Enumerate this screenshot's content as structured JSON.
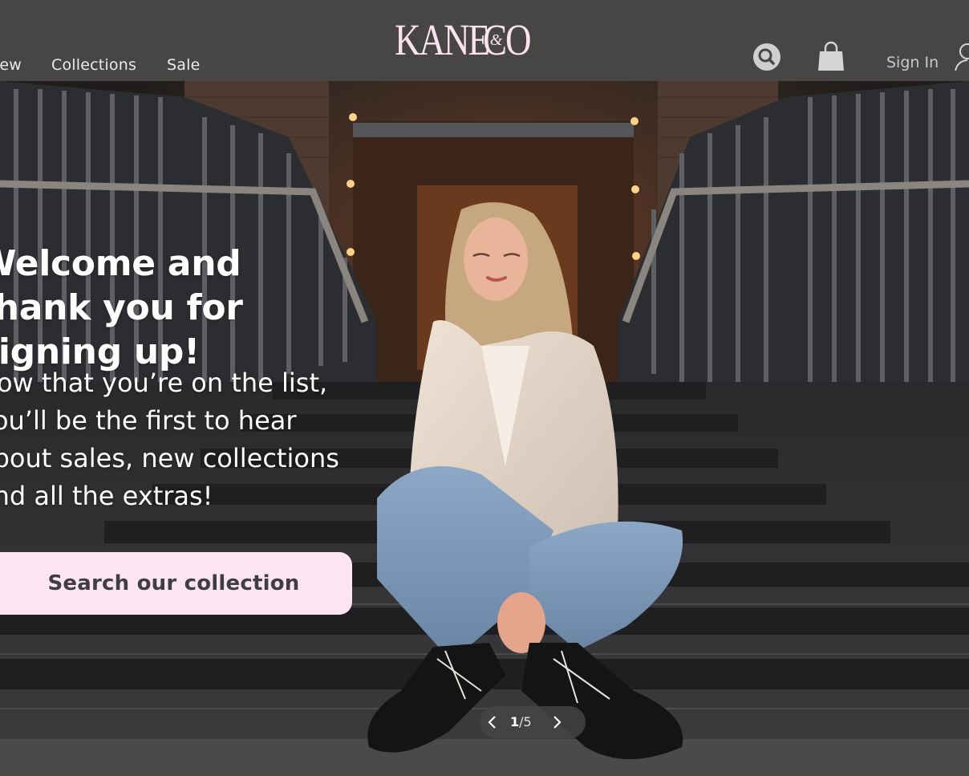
{
  "header": {
    "nav": [
      {
        "label": "New"
      },
      {
        "label": "Collections"
      },
      {
        "label": "Sale"
      }
    ],
    "logo_text": "KANE&CO",
    "logo_main_left": "KANE",
    "logo_amp": "&",
    "logo_main_right": "CO",
    "sign_in_label": "Sign In",
    "icons": [
      "search-icon",
      "shopping-bag-icon",
      "user-icon"
    ]
  },
  "hero": {
    "headline": "Welcome and thank you for signing up!",
    "subtext": "Now that you’re on the list, you’ll be the first to hear about sales, new collections and all the extras!",
    "cta_label": "Search our collection",
    "slider": {
      "current": "1",
      "separator": "/",
      "total": "5"
    }
  },
  "colors": {
    "header_bg": "#474645",
    "logo": "#fbe4ee",
    "cta_bg": "#fde5f3",
    "cta_text": "#3f3f42"
  }
}
